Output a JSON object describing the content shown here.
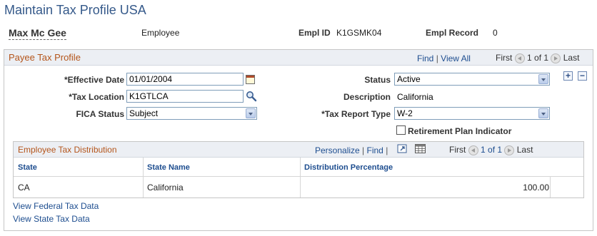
{
  "page": {
    "title": "Maintain Tax Profile USA"
  },
  "employee": {
    "name": "Max Mc Gee",
    "role": "Employee",
    "empl_id_label": "Empl ID",
    "empl_id": "K1GSMK04",
    "empl_record_label": "Empl Record",
    "empl_record": "0"
  },
  "panel": {
    "title": "Payee Tax Profile",
    "find_label": "Find",
    "view_all_label": "View All",
    "first_label": "First",
    "count_text": "1 of 1",
    "last_label": "Last"
  },
  "form": {
    "effective_date_label": "*Effective Date",
    "effective_date": "01/01/2004",
    "status_label": "Status",
    "status": "Active",
    "tax_location_label": "*Tax Location",
    "tax_location": "K1GTLCA",
    "description_label": "Description",
    "description": "California",
    "fica_status_label": "FICA Status",
    "fica_status": "Subject",
    "tax_report_type_label": "*Tax Report Type",
    "tax_report_type": "W-2",
    "retirement_plan_label": "Retirement Plan Indicator",
    "retirement_plan_checked": false,
    "add_symbol": "+",
    "remove_symbol": "−"
  },
  "distribution": {
    "title": "Employee Tax Distribution",
    "personalize_label": "Personalize",
    "find_label": "Find",
    "first_label": "First",
    "count_text": "1 of 1",
    "last_label": "Last",
    "columns": [
      "State",
      "State Name",
      "Distribution Percentage"
    ],
    "rows": [
      {
        "state": "CA",
        "state_name": "California",
        "percentage": "100.00"
      }
    ]
  },
  "links": {
    "federal": "View Federal Tax Data",
    "state": "View State Tax Data"
  },
  "icons": {
    "calendar": "calendar-icon",
    "lookup": "magnifier-icon",
    "view_all_grid": "grid-icon",
    "zoom": "zoom-icon"
  },
  "colors": {
    "title": "#35598a",
    "section_title": "#b4551b",
    "link": "#1d4d8f",
    "bar_bg": "#eceff4"
  }
}
